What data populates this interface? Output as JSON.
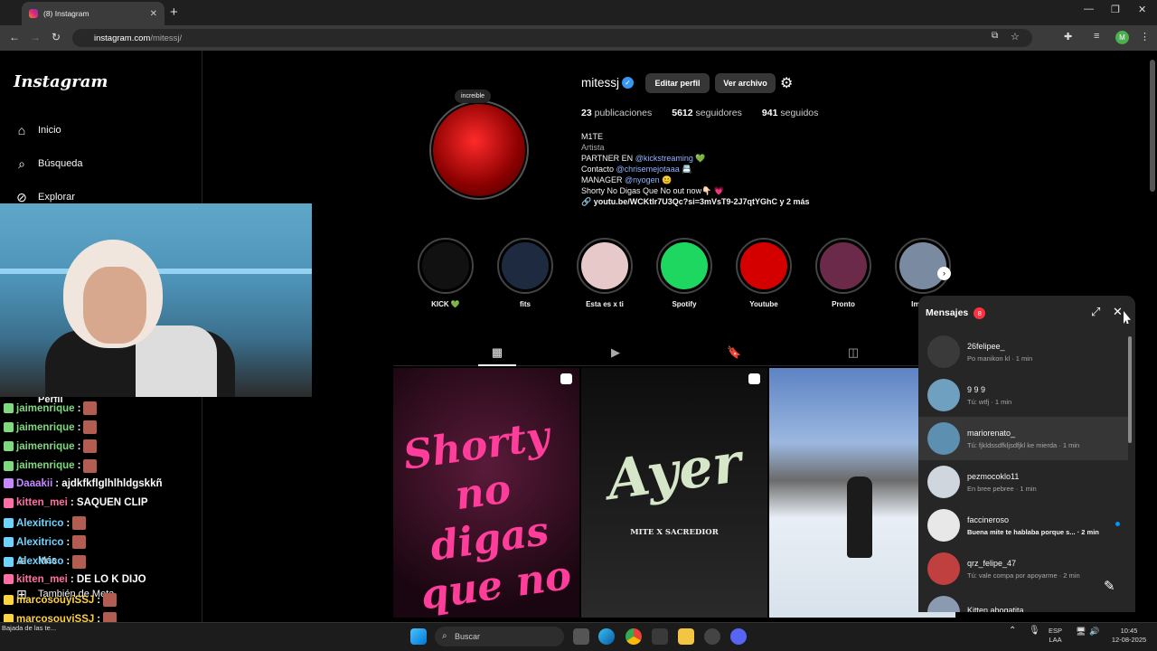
{
  "browser": {
    "tab_title": "(8) Instagram",
    "url_host": "instagram.com",
    "url_path": "/mitessj/"
  },
  "sidebar": {
    "logo": "Instagram",
    "items": [
      {
        "label": "Inicio",
        "icon": "home-icon"
      },
      {
        "label": "Búsqueda",
        "icon": "search-icon"
      },
      {
        "label": "Explorar",
        "icon": "compass-icon"
      },
      {
        "label": "Perfil",
        "icon": "profile-icon"
      },
      {
        "label": "Más",
        "icon": "menu-icon"
      },
      {
        "label": "También de Meta",
        "icon": "meta-icon"
      }
    ]
  },
  "chat": [
    {
      "user": "jaimenrique",
      "msg": ":",
      "color": "#7fd97f",
      "emote": true
    },
    {
      "user": "jaimenrique",
      "msg": ":",
      "color": "#7fd97f",
      "emote": true
    },
    {
      "user": "jaimenrique",
      "msg": ":",
      "color": "#7fd97f",
      "emote": true
    },
    {
      "user": "jaimenrique",
      "msg": ":",
      "color": "#7fd97f",
      "emote": true
    },
    {
      "user": "Daaakii",
      "msg": ": ajdkfkflglhlhldgskkñ",
      "color": "#c58aff",
      "emote": false
    },
    {
      "user": "kitten_mei",
      "msg": ": SAQUEN CLIP",
      "color": "#ff6fa5",
      "emote": false
    },
    {
      "user": "Alexitrico",
      "msg": ":",
      "color": "#6fd3ff",
      "emote": true
    },
    {
      "user": "Alexitrico",
      "msg": ":",
      "color": "#6fd3ff",
      "emote": true
    },
    {
      "user": "Alexitrico",
      "msg": ":",
      "color": "#6fd3ff",
      "emote": true
    },
    {
      "user": "kitten_mei",
      "msg": ": DE LO K DIJO",
      "color": "#ff6fa5",
      "emote": false
    },
    {
      "user": "marcosouyiSSJ",
      "msg": ":",
      "color": "#ffd23f",
      "emote": true
    },
    {
      "user": "marcosouyiSSJ",
      "msg": ":",
      "color": "#ffd23f",
      "emote": true
    },
    {
      "user": "marcosouyiSSJ",
      "msg": ":",
      "color": "#ffd23f",
      "emote": true
    }
  ],
  "profile": {
    "username": "mitessj",
    "edit_btn": "Editar perfil",
    "archive_btn": "Ver archivo",
    "note": "increible",
    "posts_count": "23",
    "posts_label": "publicaciones",
    "followers_count": "5612",
    "followers_label": "seguidores",
    "following_count": "941",
    "following_label": "seguidos",
    "bio_name": "M1TE",
    "bio_category": "Artista",
    "bio_l1_a": "PARTNER EN ",
    "bio_l1_link": "@kickstreaming",
    "bio_l1_b": " 💚",
    "bio_l2_a": "Contacto ",
    "bio_l2_link": "@chrisemejotaaa",
    "bio_l2_b": " 📇",
    "bio_l3_a": "MANAGER ",
    "bio_l3_link": "@nyogen",
    "bio_l3_b": " 😊",
    "bio_l4": "Shorty No Digas Que No out now👇🏻 💗",
    "bio_link": "youtu.be/WCKtlr7U3Qc?si=3mVsT9-2J7qtYGhC y 2 más"
  },
  "highlights": [
    {
      "label": "KICK 💚",
      "color": "#111"
    },
    {
      "label": "fits",
      "color": "#1d2a3f"
    },
    {
      "label": "Esta es x ti",
      "color": "#e8c9c9"
    },
    {
      "label": "Spotify",
      "color": "#1ed760"
    },
    {
      "label": "Youtube",
      "color": "#d40000"
    },
    {
      "label": "Pronto",
      "color": "#6b2a4a"
    },
    {
      "label": "Implan",
      "color": "#7a8aa0"
    }
  ],
  "posts": [
    {
      "text": "Shorty no digas que no",
      "bg": "#2a1020"
    },
    {
      "text": "Ayer",
      "sub": "MITE X SACREDIOR",
      "bg": "#1a1a1a"
    },
    {
      "text": "",
      "bg": "#5f7aa8"
    }
  ],
  "messages": {
    "title": "Mensajes",
    "badge": "8",
    "items": [
      {
        "name": "26felipee_",
        "preview": "Po manikon kl · 1 min",
        "av": "#3a3a3a",
        "unread": false,
        "sel": false
      },
      {
        "name": "9 9 9",
        "preview": "Tú: wtfj · 1 min",
        "av": "#6fa0c0",
        "unread": false,
        "sel": false
      },
      {
        "name": "mariorenato_",
        "preview": "Tú: fjkldssdfkljsdfjkl ke mierda · 1 min",
        "av": "#5d8fb0",
        "unread": false,
        "sel": true
      },
      {
        "name": "pezmocoklo11",
        "preview": "En bree pebree · 1 min",
        "av": "#cfd6dd",
        "unread": false,
        "sel": false
      },
      {
        "name": "faccineroso",
        "preview": "Buena mite te hablaba porque s... · 2 min",
        "av": "#e8e8e8",
        "unread": true,
        "sel": false
      },
      {
        "name": "qrz_felipe_47",
        "preview": "Tú: vale compa por apoyarme · 2 min",
        "av": "#c04040",
        "unread": false,
        "sel": false
      },
      {
        "name": "Kitten abogatita",
        "preview": "",
        "av": "#8a9ab0",
        "unread": false,
        "sel": false
      }
    ]
  },
  "taskbar": {
    "search": "Buscar",
    "lang1": "ESP",
    "lang2": "LAA",
    "time": "10:45",
    "date": "12-08-2025",
    "notif": "Bajada de las te..."
  }
}
